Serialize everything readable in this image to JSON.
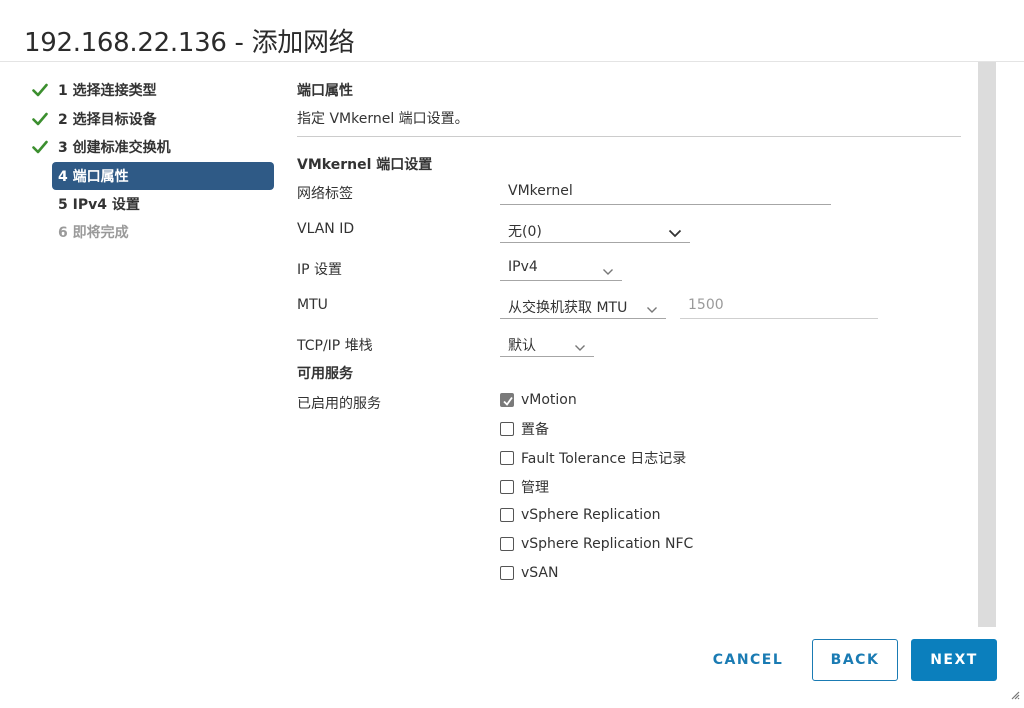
{
  "window": {
    "title": "192.168.22.136 - 添加网络"
  },
  "steps": [
    {
      "label": "1 选择连接类型",
      "state": "done"
    },
    {
      "label": "2 选择目标设备",
      "state": "done"
    },
    {
      "label": "3 创建标准交换机",
      "state": "done"
    },
    {
      "label": "4 端口属性",
      "state": "active"
    },
    {
      "label": "5 IPv4 设置",
      "state": "pending"
    },
    {
      "label": "6 即将完成",
      "state": "disabled"
    }
  ],
  "page": {
    "heading": "端口属性",
    "description": "指定 VMkernel 端口设置。"
  },
  "vmkernel_settings": {
    "heading": "VMkernel 端口设置",
    "network_label": {
      "label": "网络标签",
      "value": "VMkernel"
    },
    "vlan_id": {
      "label": "VLAN ID",
      "value": "无(0)"
    },
    "ip_settings": {
      "label": "IP 设置",
      "value": "IPv4"
    },
    "mtu": {
      "label": "MTU",
      "value": "从交换机获取 MTU",
      "placeholder": "1500"
    },
    "tcpip_stack": {
      "label": "TCP/IP 堆栈",
      "value": "默认"
    }
  },
  "services": {
    "heading": "可用服务",
    "enabled_label": "已启用的服务",
    "items": [
      {
        "label": "vMotion",
        "checked": true
      },
      {
        "label": "置备",
        "checked": false
      },
      {
        "label": "Fault Tolerance 日志记录",
        "checked": false
      },
      {
        "label": "管理",
        "checked": false
      },
      {
        "label": "vSphere Replication",
        "checked": false
      },
      {
        "label": "vSphere Replication NFC",
        "checked": false
      },
      {
        "label": "vSAN",
        "checked": false
      }
    ]
  },
  "footer": {
    "cancel_label": "CANCEL",
    "back_label": "BACK",
    "next_label": "NEXT"
  },
  "colors": {
    "accent": "#0b7fbd",
    "active_step": "#2f5a86",
    "check_green": "#3c8f2f"
  }
}
